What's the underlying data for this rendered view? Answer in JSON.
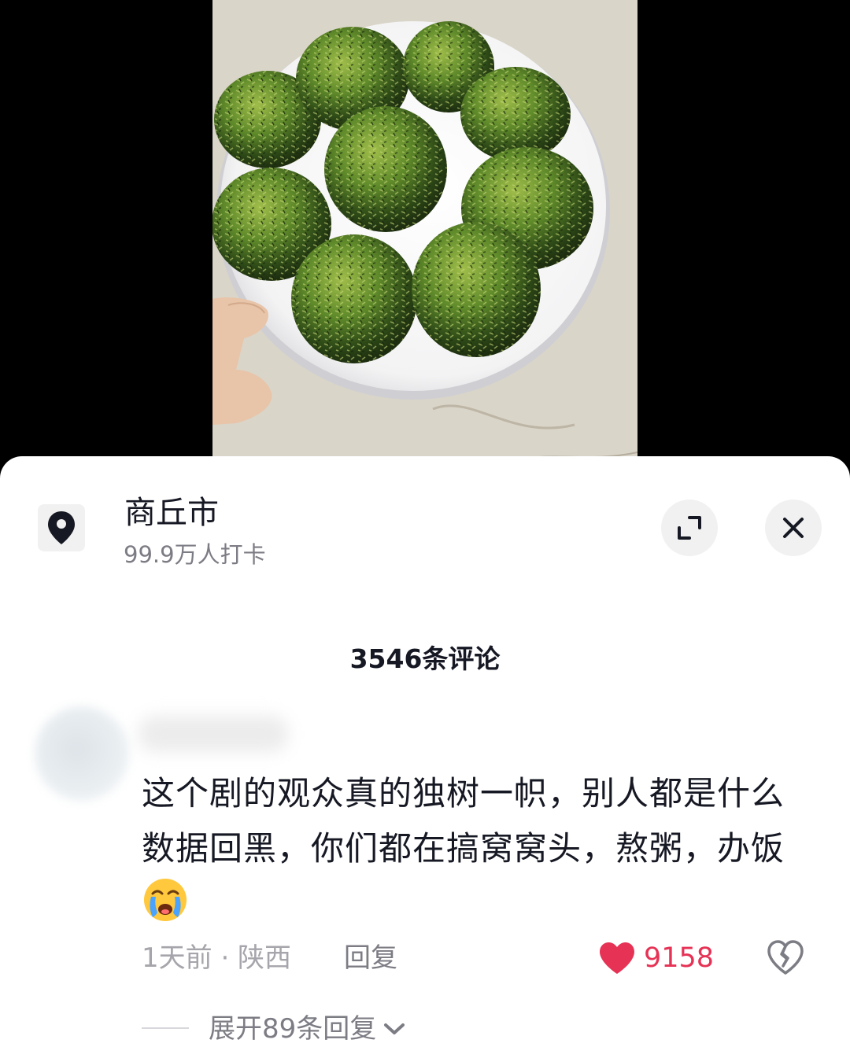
{
  "location": {
    "name": "商丘市",
    "checkins": "99.9万人打卡"
  },
  "comments_header": {
    "count_label": "3546条评论"
  },
  "comment": {
    "text": "这个剧的观众真的独树一帜，别人都是什么数据回黑，你们都在搞窝窝头，熬粥，办饭",
    "emoji": "crying-face-emoji",
    "time_location": "1天前 · 陕西",
    "reply_label": "回复",
    "like_count": "9158",
    "expand_replies_label": "展开89条回复"
  },
  "colors": {
    "like": "#e63255",
    "text_primary": "#161823",
    "text_secondary": "#7c7c84"
  },
  "icons": [
    "location-pin-icon",
    "expand-icon",
    "close-icon",
    "heart-icon",
    "broken-heart-icon",
    "chevron-down-icon"
  ]
}
